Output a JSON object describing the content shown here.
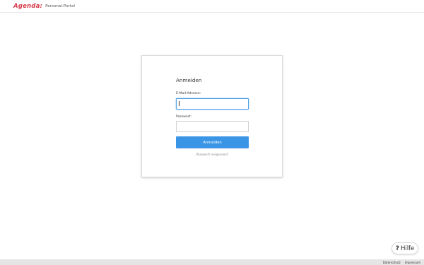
{
  "header": {
    "logo_text": "Agenda:",
    "portal_title": "Personal-Portal"
  },
  "login": {
    "title": "Anmelden",
    "email_label": "E-Mail-Adresse:",
    "email_value": "",
    "password_label": "Passwort:",
    "password_value": "",
    "submit_label": "Anmelden",
    "forgot_label": "Passwort vergessen?"
  },
  "help": {
    "icon": "question-mark-icon",
    "icon_glyph": "?",
    "label": "Hilfe"
  },
  "footer": {
    "links": [
      "Datenschutz",
      "Impressum"
    ]
  },
  "colors": {
    "brand": "#d33a4b",
    "accent": "#3a95e6",
    "focus_border": "#4a9de8",
    "footer_bg": "#e5e5e5"
  }
}
